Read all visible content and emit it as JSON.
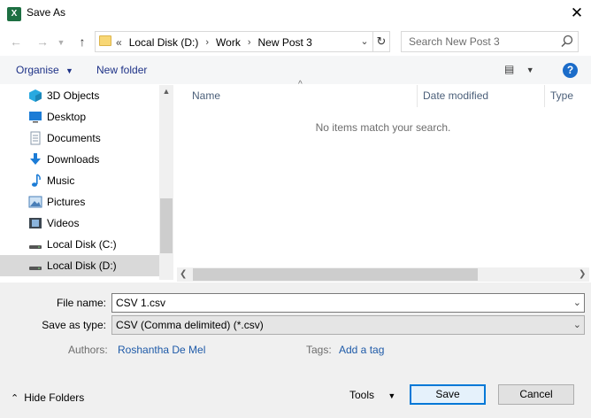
{
  "window": {
    "title": "Save As",
    "app_icon_letter": "X"
  },
  "nav": {
    "back_icon": "arrow-left-icon",
    "forward_icon": "arrow-right-icon",
    "recent_icon": "chevron-down-icon",
    "up_icon": "arrow-up-icon",
    "address_prefix": "«",
    "breadcrumbs": [
      "Local Disk (D:)",
      "Work",
      "New Post 3"
    ],
    "search_placeholder": "Search New Post 3"
  },
  "toolbar": {
    "organise": "Organise",
    "new_folder": "New folder",
    "help": "?"
  },
  "sidebar": {
    "items": [
      {
        "label": "3D Objects",
        "icon": "3d-objects-icon",
        "color": "#29a9e0"
      },
      {
        "label": "Desktop",
        "icon": "desktop-icon",
        "color": "#1c7cd6"
      },
      {
        "label": "Documents",
        "icon": "documents-icon",
        "color": "#8a9aab"
      },
      {
        "label": "Downloads",
        "icon": "downloads-icon",
        "color": "#1c7cd6"
      },
      {
        "label": "Music",
        "icon": "music-icon",
        "color": "#1c7cd6"
      },
      {
        "label": "Pictures",
        "icon": "pictures-icon",
        "color": "#4a7fb8"
      },
      {
        "label": "Videos",
        "icon": "videos-icon",
        "color": "#3c4650"
      },
      {
        "label": "Local Disk (C:)",
        "icon": "drive-icon",
        "color": "#555555"
      },
      {
        "label": "Local Disk (D:)",
        "icon": "drive-icon",
        "color": "#555555",
        "selected": true
      }
    ]
  },
  "file_list": {
    "columns": [
      "Name",
      "Date modified",
      "Type"
    ],
    "empty_message": "No items match your search."
  },
  "form": {
    "file_name_label": "File name:",
    "file_name_value": "CSV 1.csv",
    "save_type_label": "Save as type:",
    "save_type_value": "CSV (Comma delimited) (*.csv)",
    "authors_label": "Authors:",
    "authors_value": "Roshantha De Mel",
    "tags_label": "Tags:",
    "tags_value": "Add a tag"
  },
  "footer": {
    "hide_folders": "Hide Folders",
    "tools": "Tools",
    "save": "Save",
    "cancel": "Cancel"
  },
  "colors": {
    "accent": "#0078d7",
    "link": "#1e5aa8",
    "excel_green": "#1d6f42"
  }
}
